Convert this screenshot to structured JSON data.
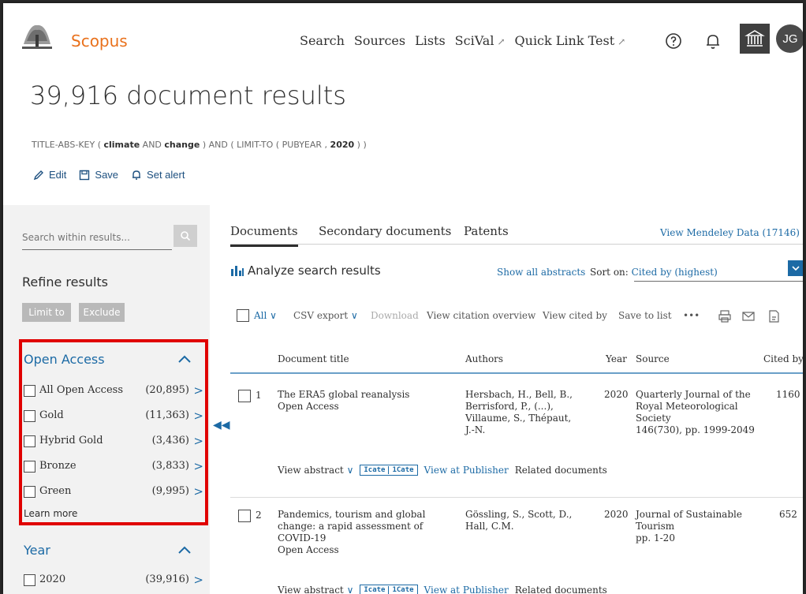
{
  "header": {
    "logo_text": "Scopus",
    "nav": [
      "Search",
      "Sources",
      "Lists",
      "SciVal",
      "Quick Link Test"
    ],
    "external_marker": "↗",
    "avatar_initials": "JG"
  },
  "results": {
    "title": "39,916 document results",
    "query": {
      "p1": "TITLE-ABS-KEY ( ",
      "b1": "climate",
      "p2": " AND ",
      "b2": "change",
      "p3": " ) AND ( LIMIT-TO ( PUBYEAR , ",
      "b3": "2020",
      "p4": " ) )"
    },
    "actions": {
      "edit": "Edit",
      "save": "Save",
      "alert": "Set alert"
    }
  },
  "sidebar": {
    "search_placeholder": "Search within results...",
    "refine_title": "Refine results",
    "limit_to": "Limit to",
    "exclude": "Exclude",
    "open_access": {
      "title": "Open Access",
      "items": [
        {
          "label": "All Open Access",
          "count": "(20,895)"
        },
        {
          "label": "Gold",
          "count": "(11,363)"
        },
        {
          "label": "Hybrid Gold",
          "count": "(3,436)"
        },
        {
          "label": "Bronze",
          "count": "(3,833)"
        },
        {
          "label": "Green",
          "count": "(9,995)"
        }
      ],
      "learn_more": "Learn more"
    },
    "year": {
      "title": "Year",
      "items": [
        {
          "label": "2020",
          "count": "(39,916)"
        }
      ]
    },
    "highlight_color": "#e00000"
  },
  "main": {
    "tabs": [
      "Documents",
      "Secondary documents",
      "Patents"
    ],
    "mendeley": "View Mendeley Data (17146)",
    "analyze": "Analyze search results",
    "show_abstracts": "Show all abstracts",
    "sort_label": "Sort on:",
    "sort_value": "Cited by (highest)",
    "toolbar": {
      "all": "All",
      "csv_export": "CSV export",
      "download": "Download",
      "citation_overview": "View citation overview",
      "cited_by": "View cited by",
      "save_to_list": "Save to list",
      "more": "•••"
    },
    "columns": [
      "Document title",
      "Authors",
      "Year",
      "Source",
      "Cited by"
    ],
    "rows": [
      {
        "num": "1",
        "title": "The ERA5 global reanalysis",
        "access": "Open Access",
        "authors": "Hersbach, H., Bell, B., Berrisford, P., (...), Villaume, S., Thépaut, J.-N.",
        "year": "2020",
        "source": "Quarterly Journal of the Royal Meteorological Society",
        "source_detail": "146(730), pp. 1999-2049",
        "cited": "1160"
      },
      {
        "num": "2",
        "title": "Pandemics, tourism and global change: a rapid assessment of COVID-19",
        "access": "Open Access",
        "authors": "Gössling, S., Scott, D., Hall, C.M.",
        "year": "2020",
        "source": "Journal of Sustainable Tourism",
        "source_detail": "pp. 1-20",
        "cited": "652"
      }
    ],
    "row_actions": {
      "view_abstract": "View abstract",
      "badge_a": "Icate",
      "badge_b": "1Cate",
      "publisher": "View at Publisher",
      "related": "Related documents"
    }
  }
}
